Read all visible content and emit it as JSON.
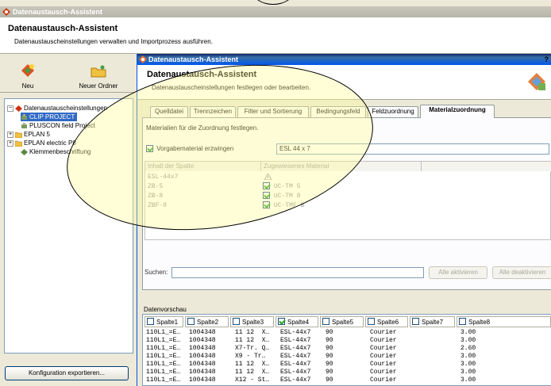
{
  "outer": {
    "title": "Datenaustausch-Assistent",
    "heading": "Datenaustausch-Assistent",
    "subtitle": "Datenaustauscheinstellungen verwalten und Importprozess ausführen.",
    "toolbar": {
      "new_label": "Neu",
      "new_folder_label": "Neuer Ordner"
    },
    "tree": [
      "Datenaustauscheinstellungen",
      "CLIP PROJECT",
      "PLUSCON field Project",
      "EPLAN 5",
      "EPLAN electric P8",
      "Klemmenbeschriftung"
    ],
    "export_button": "Konfiguration exportieren..."
  },
  "inner": {
    "title": "Datenaustausch-Assistent",
    "help": "?",
    "heading": "Datenaustausch-Assistent",
    "subtitle": "Datenaustauscheinstellungen festlegen oder bearbeiten.",
    "tabs": [
      "Quelldatei",
      "Trennzeichen",
      "Filter und Sortierung",
      "Bedingungsfeld",
      "Feldzuordnung",
      "Materialzuordnung"
    ],
    "active_tab": "Materialzuordnung",
    "instruction": "Materialien für die Zuordnung festlegen.",
    "force_label": "Vorgabematerial erzwingen",
    "force_checked": true,
    "default_material": "ESL 44 x 7",
    "grid": {
      "headers": [
        "Inhalt der Spalte",
        "Zugewiesenes Material"
      ],
      "rows": [
        [
          "ESL-44x7",
          ""
        ],
        [
          "ZB-5",
          "UC-TM 5"
        ],
        [
          "ZB-8",
          "UC-TM 8"
        ],
        [
          "ZBF-8",
          "UC-TMF 8"
        ]
      ]
    },
    "search_label": "Suchen:",
    "search_value": "",
    "activate_all": "Alle aktivieren",
    "deactivate_all": "Alle deaktivieren",
    "preview": {
      "label": "Datenvorschau",
      "columns": [
        {
          "name": "Spalte1",
          "checked": false
        },
        {
          "name": "Spalte2",
          "checked": false
        },
        {
          "name": "Spalte3",
          "checked": false
        },
        {
          "name": "Spalte4",
          "checked": true
        },
        {
          "name": "Spalte5",
          "checked": false
        },
        {
          "name": "Spalte6",
          "checked": false
        },
        {
          "name": "Spalte7",
          "checked": false
        },
        {
          "name": "Spalte8",
          "checked": false
        }
      ],
      "rows": [
        [
          "110L1_=E…",
          "1004348",
          "11 12  X…",
          "ESL-44x7",
          "90",
          "Courier",
          "3.00"
        ],
        [
          "110L1_=E…",
          "1004348",
          "11 12  X…",
          "ESL-44x7",
          "90",
          "Courier",
          "3.00"
        ],
        [
          "110L1_=E…",
          "1004348",
          "X7-Tr. Q…",
          "ESL-44x7",
          "90",
          "Courier",
          "2.60"
        ],
        [
          "110L1_=E…",
          "1004348",
          "X9 - Tr…",
          "ESL-44x7",
          "90",
          "Courier",
          "3.00"
        ],
        [
          "110L1_=E…",
          "1004348",
          "11 12  X…",
          "ESL-44x7",
          "90",
          "Courier",
          "3.00"
        ],
        [
          "110L1_=E…",
          "1004348",
          "11 12  X…",
          "ESL-44x7",
          "90",
          "Courier",
          "3.00"
        ],
        [
          "110L1_=E…",
          "1004348",
          "X12 - St…",
          "ESL-44x7",
          "90",
          "Courier",
          "3.00"
        ]
      ]
    }
  },
  "colors": {
    "accent": "#0058ee",
    "highlight": "#fffd96",
    "selection": "#316ac5"
  }
}
